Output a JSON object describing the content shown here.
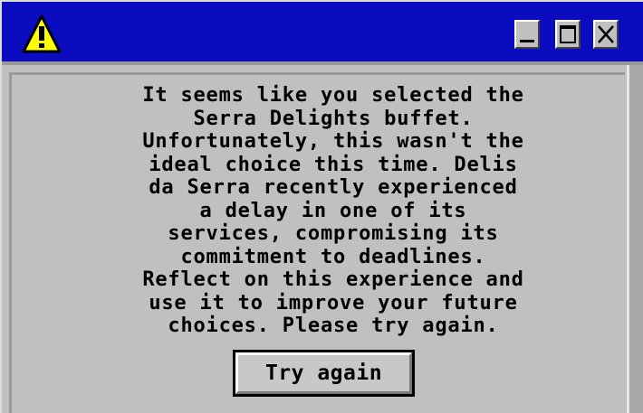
{
  "window": {
    "title_icon": "warning-icon",
    "controls": {
      "minimize_icon": "minimize-icon",
      "maximize_icon": "maximize-icon",
      "close_icon": "close-icon"
    }
  },
  "dialog": {
    "message_lines": [
      "It seems like you selected the",
      "Serra Delights buffet.",
      "Unfortunately, this wasn't the",
      "ideal choice this time. Delis",
      "da Serra recently experienced",
      "a delay in one of its",
      "services, compromising its",
      "commitment to deadlines.",
      "Reflect on this experience and",
      "use it to improve your future",
      "choices. Please try again."
    ],
    "button_label": "Try again"
  },
  "colors": {
    "titlebar": "#0b0bbf",
    "window_face": "#c0c0c0",
    "warning_fill": "#ffff00"
  }
}
